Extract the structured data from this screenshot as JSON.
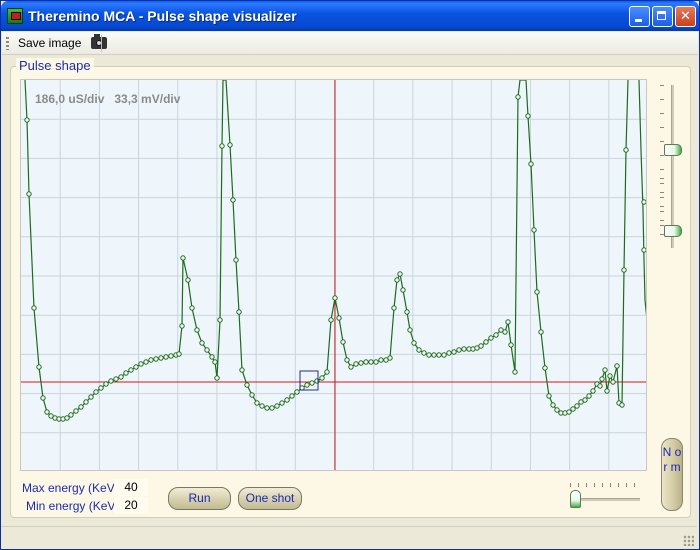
{
  "window": {
    "title": "Theremino MCA - Pulse shape visualizer"
  },
  "toolbar": {
    "save_label": "Save image"
  },
  "group": {
    "title": "Pulse shape"
  },
  "plot": {
    "scale_text": "186,0 uS/div   33,3 mV/div",
    "colors": {
      "background": "#eef6fc",
      "grid": "#c8d4dc",
      "trace": "#1e6b1e",
      "cursor": "#d01818",
      "marker": "#2a2a80"
    }
  },
  "fields": {
    "max_energy_label": "Max energy (KeV)",
    "max_energy_value": "40",
    "min_energy_label": "Min energy (KeV)",
    "min_energy_value": "20"
  },
  "buttons": {
    "run": "Run",
    "one_shot": "One shot",
    "norm": "N o r m"
  }
}
